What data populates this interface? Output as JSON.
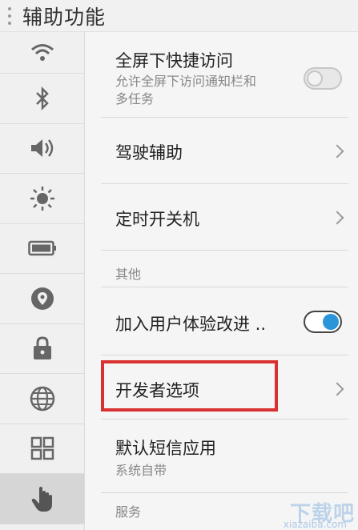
{
  "header": {
    "title": "辅助功能"
  },
  "sidebar": {
    "items": [
      {
        "icon": "wifi-icon"
      },
      {
        "icon": "bluetooth-icon"
      },
      {
        "icon": "volume-icon"
      },
      {
        "icon": "brightness-icon"
      },
      {
        "icon": "battery-icon"
      },
      {
        "icon": "location-icon"
      },
      {
        "icon": "lock-icon"
      },
      {
        "icon": "globe-icon"
      },
      {
        "icon": "apps-grid-icon"
      },
      {
        "icon": "hand-gesture-icon",
        "active": true
      }
    ]
  },
  "main": {
    "fullscreen_access": {
      "title": "全屏下快捷访问",
      "subtitle_line1": "允许全屏下访问通知栏和",
      "subtitle_line2": "多任务",
      "toggle": "off"
    },
    "driving_assist": {
      "title": "驾驶辅助"
    },
    "scheduled_power": {
      "title": "定时开关机"
    },
    "other_section": "其他",
    "ux_program": {
      "title": "加入用户体验改进 ..",
      "toggle": "on"
    },
    "developer_options": {
      "title": "开发者选项"
    },
    "default_sms": {
      "title": "默认短信应用",
      "subtitle": "系统自带"
    },
    "service_section": "服务"
  },
  "colors": {
    "accent": "#2a96d9",
    "highlight": "#d9312f"
  },
  "watermark": {
    "text": "下载吧",
    "url": "xiazaiba.com"
  }
}
